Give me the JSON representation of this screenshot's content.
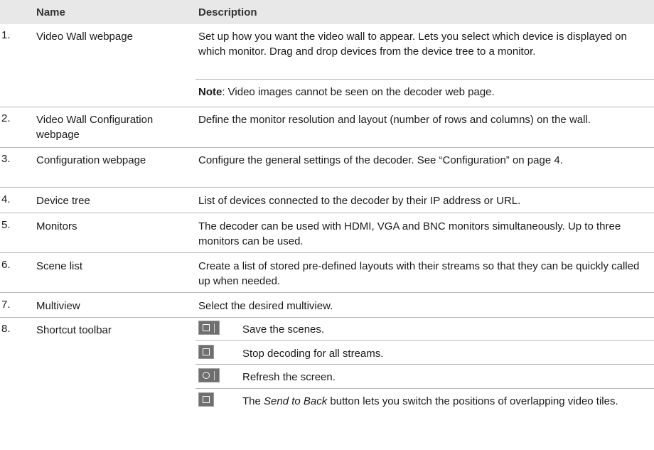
{
  "header": {
    "name": "Name",
    "description": "Description"
  },
  "rows": [
    {
      "num": "1.",
      "name": "Video Wall webpage",
      "description": "Set up how you want the video wall to appear. Lets you select which device is displayed on which monitor. Drag and drop devices from the device tree to a monitor.",
      "note_label": "Note",
      "note_text": ": Video images cannot be seen on the decoder web page."
    },
    {
      "num": "2.",
      "name": "Video Wall Configuration webpage",
      "description": "Define the monitor resolution and layout (number of rows and columns) on the wall."
    },
    {
      "num": "3.",
      "name": "Configuration webpage",
      "description": "Configure the general settings of the decoder. See “Configuration” on page 4."
    },
    {
      "num": "4.",
      "name": "Device tree",
      "description": "List of devices connected to the decoder by their IP address or URL."
    },
    {
      "num": "5.",
      "name": "Monitors",
      "description": "The decoder can be used with HDMI, VGA and BNC monitors simultaneously. Up to three monitors can be used."
    },
    {
      "num": "6.",
      "name": "Scene list",
      "description": "Create a list of stored pre-defined layouts with their streams so that they can be quickly called up when needed."
    },
    {
      "num": "7.",
      "name": "Multiview",
      "description": "Select the desired multiview."
    },
    {
      "num": "8.",
      "name": "Shortcut toolbar",
      "tools": [
        {
          "icon": "save-scene-icon",
          "text": "Save the scenes."
        },
        {
          "icon": "stop-decoding-icon",
          "text": "Stop decoding for all streams."
        },
        {
          "icon": "refresh-icon",
          "text": "Refresh the screen."
        },
        {
          "icon": "send-to-back-icon",
          "text_pre": "The ",
          "text_em": "Send to Back",
          "text_post": " button lets you switch the positions of overlapping video tiles."
        }
      ]
    }
  ]
}
